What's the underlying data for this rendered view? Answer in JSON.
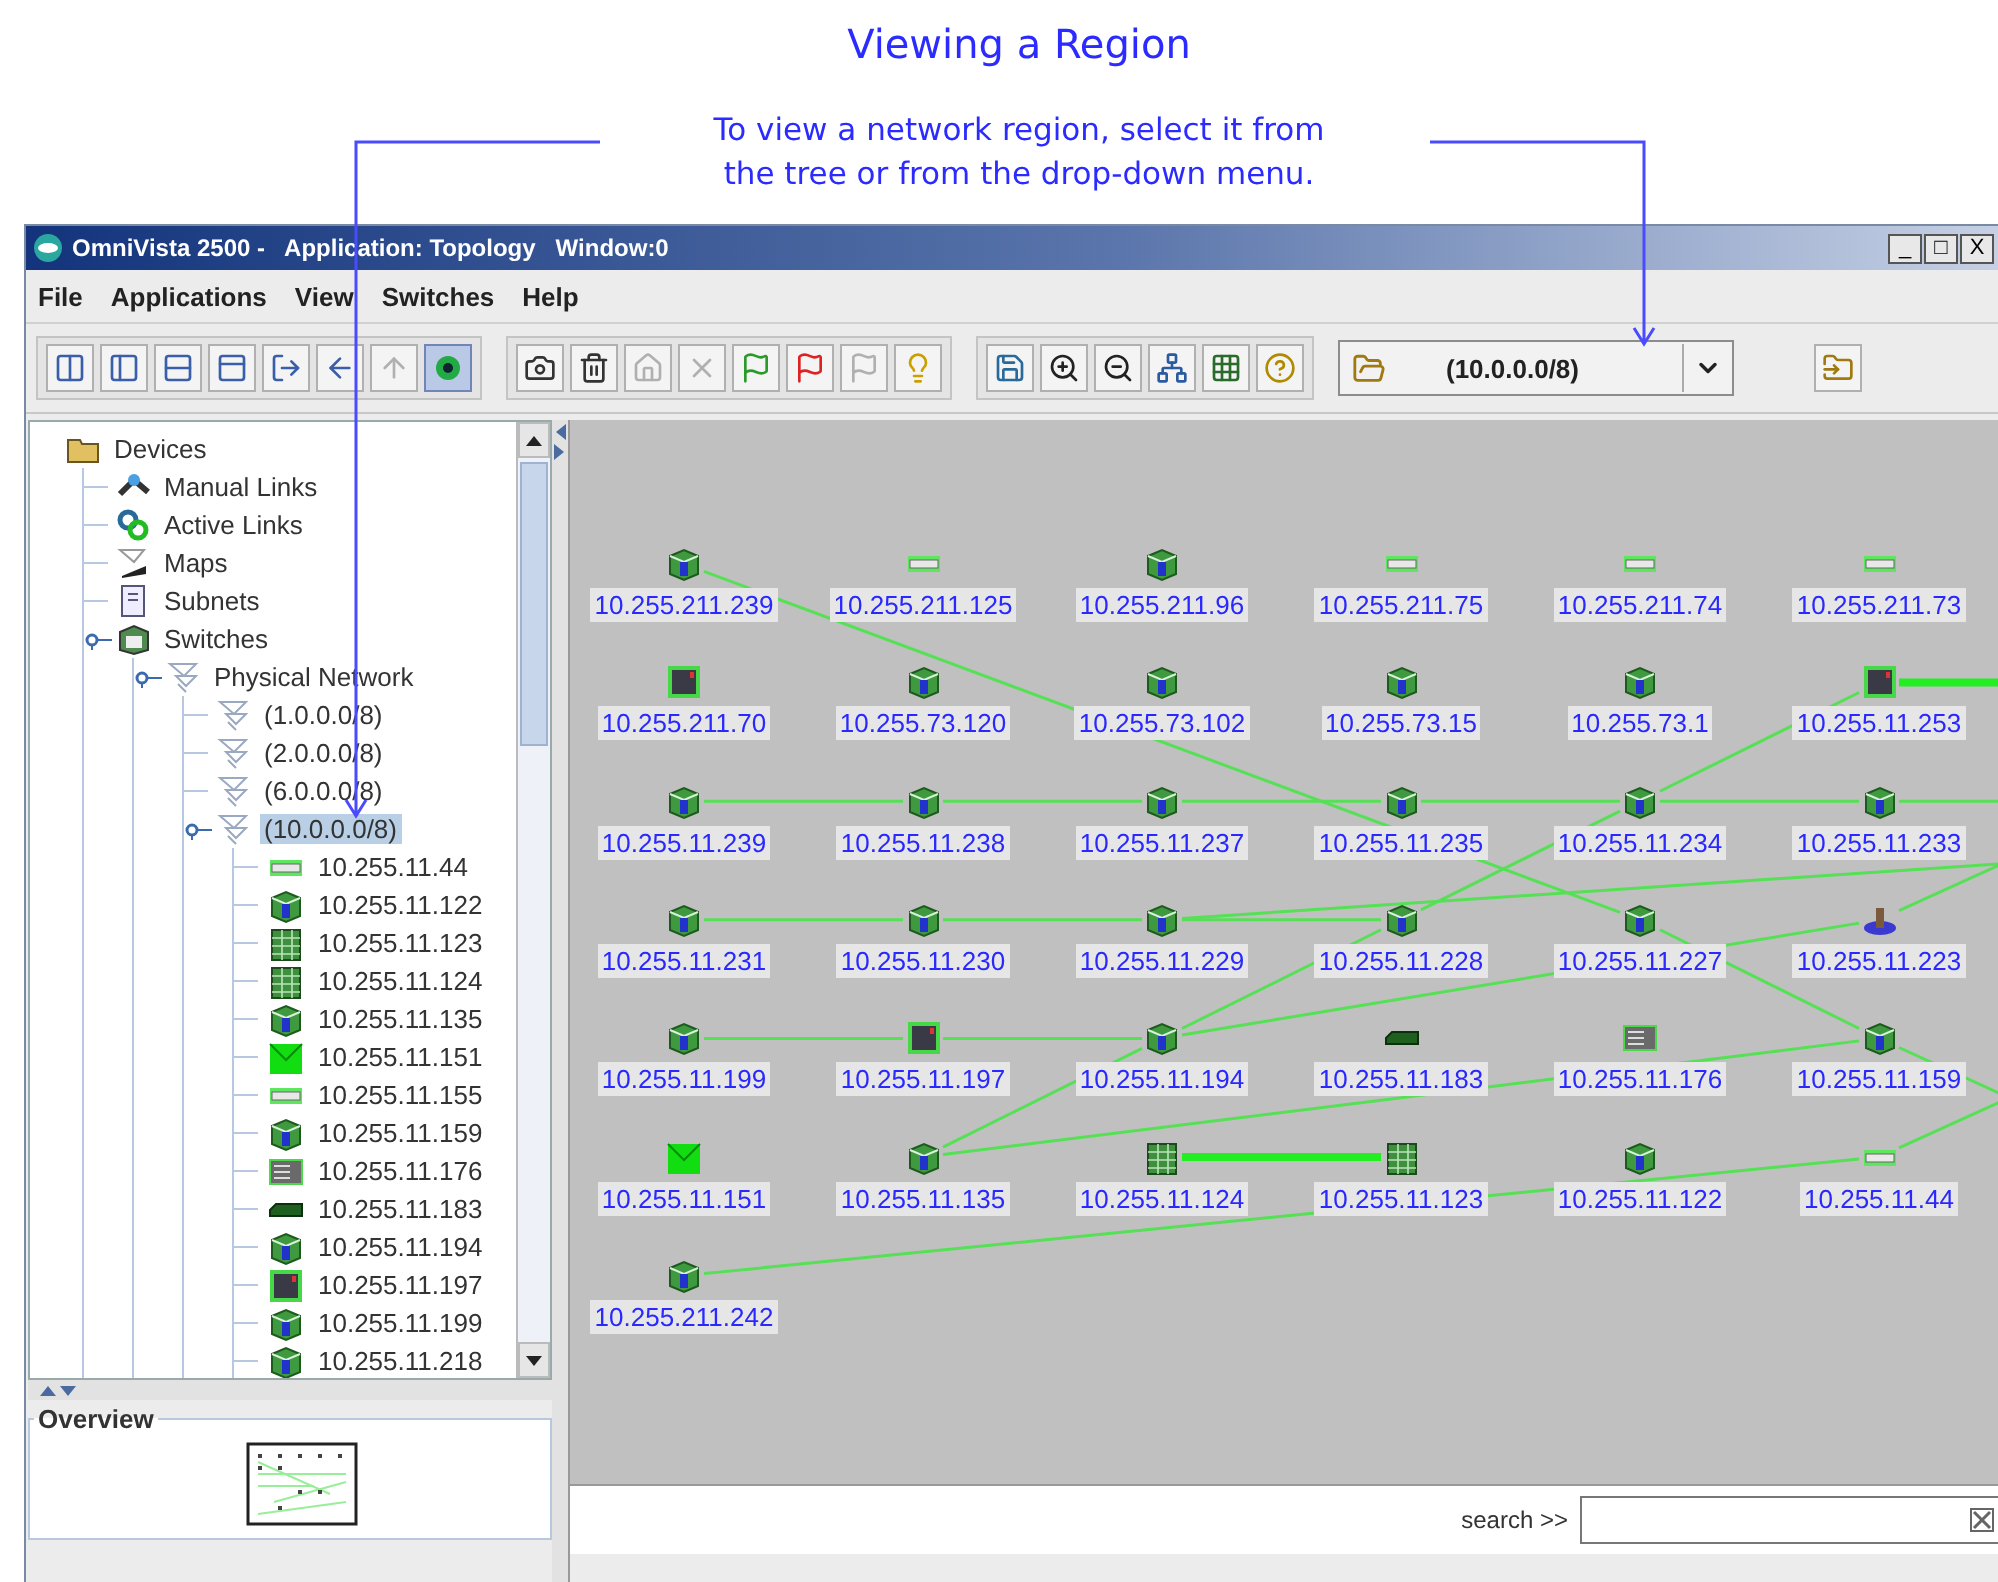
{
  "caption": {
    "title": "Viewing a Region",
    "note": [
      "To view a network region, select it from",
      "the tree or from the drop-down menu."
    ]
  },
  "window": {
    "title": "OmniVista 2500 -   Application: Topology   Window:0",
    "controls": [
      "_",
      "□",
      "X"
    ]
  },
  "menu": [
    "File",
    "Applications",
    "View",
    "Switches",
    "Help"
  ],
  "toolbar": [
    [
      {
        "kind": "panes-columns",
        "disabled": false,
        "pressed": false
      },
      {
        "kind": "panes-left",
        "disabled": false,
        "pressed": false
      },
      {
        "kind": "panes-rows",
        "disabled": false,
        "pressed": false
      },
      {
        "kind": "panes-top",
        "disabled": false,
        "pressed": false
      },
      {
        "kind": "export",
        "disabled": false,
        "pressed": false
      },
      {
        "kind": "back",
        "disabled": false,
        "pressed": false
      },
      {
        "kind": "up",
        "disabled": true,
        "pressed": false
      },
      {
        "kind": "target",
        "disabled": false,
        "pressed": true
      }
    ],
    [
      {
        "kind": "camera",
        "disabled": false,
        "pressed": false
      },
      {
        "kind": "bin",
        "disabled": false,
        "pressed": false
      },
      {
        "kind": "home",
        "disabled": true,
        "pressed": false
      },
      {
        "kind": "close",
        "disabled": true,
        "pressed": false
      },
      {
        "kind": "flag",
        "disabled": false,
        "pressed": false
      },
      {
        "kind": "flag-red",
        "disabled": false,
        "pressed": false
      },
      {
        "kind": "flag",
        "disabled": true,
        "pressed": false
      },
      {
        "kind": "bulb",
        "disabled": false,
        "pressed": false
      }
    ],
    [
      {
        "kind": "save",
        "disabled": false,
        "pressed": false
      },
      {
        "kind": "zoom-in",
        "disabled": false,
        "pressed": false
      },
      {
        "kind": "zoom-out",
        "disabled": false,
        "pressed": false
      },
      {
        "kind": "network",
        "disabled": false,
        "pressed": false
      },
      {
        "kind": "grid",
        "disabled": false,
        "pressed": false
      },
      {
        "kind": "help",
        "disabled": false,
        "pressed": false
      }
    ]
  ],
  "region_dropdown": {
    "value": "(10.0.0.0/8)"
  },
  "tree": [
    {
      "label": "Devices",
      "kind": "folder",
      "selected": false,
      "children": [
        {
          "label": "Manual Links",
          "kind": "manual-links",
          "selected": false,
          "expanded": false
        },
        {
          "label": "Active Links",
          "kind": "active-links",
          "selected": false,
          "expanded": false
        },
        {
          "label": "Maps",
          "kind": "maps",
          "selected": false,
          "expanded": false
        },
        {
          "label": "Subnets",
          "kind": "subnets",
          "selected": false,
          "expanded": false
        },
        {
          "label": "Switches",
          "kind": "switches",
          "selected": false,
          "expanded": true,
          "children": [
            {
              "label": "Physical Network",
              "kind": "network",
              "selected": false,
              "expanded": true,
              "children": [
                {
                  "label": "(1.0.0.0/8)",
                  "kind": "network",
                  "selected": false,
                  "expanded": false
                },
                {
                  "label": "(2.0.0.0/8)",
                  "kind": "network",
                  "selected": false,
                  "expanded": false
                },
                {
                  "label": "(6.0.0.0/8)",
                  "kind": "network",
                  "selected": false,
                  "expanded": false
                },
                {
                  "label": "(10.0.0.0/8)",
                  "kind": "network",
                  "selected": true,
                  "expanded": true,
                  "children": [
                    {
                      "label": "10.255.11.44",
                      "kind": "flat",
                      "selected": false
                    },
                    {
                      "label": "10.255.11.122",
                      "kind": "cube",
                      "selected": false
                    },
                    {
                      "label": "10.255.11.123",
                      "kind": "stack",
                      "selected": false
                    },
                    {
                      "label": "10.255.11.124",
                      "kind": "stack",
                      "selected": false
                    },
                    {
                      "label": "10.255.11.135",
                      "kind": "cube",
                      "selected": false
                    },
                    {
                      "label": "10.255.11.151",
                      "kind": "panel",
                      "selected": false
                    },
                    {
                      "label": "10.255.11.155",
                      "kind": "flat",
                      "selected": false
                    },
                    {
                      "label": "10.255.11.159",
                      "kind": "cube",
                      "selected": false
                    },
                    {
                      "label": "10.255.11.176",
                      "kind": "rack",
                      "selected": false
                    },
                    {
                      "label": "10.255.11.183",
                      "kind": "slim",
                      "selected": false
                    },
                    {
                      "label": "10.255.11.194",
                      "kind": "cube",
                      "selected": false
                    },
                    {
                      "label": "10.255.11.197",
                      "kind": "chassis",
                      "selected": false
                    },
                    {
                      "label": "10.255.11.199",
                      "kind": "cube",
                      "selected": false
                    },
                    {
                      "label": "10.255.11.218",
                      "kind": "cube",
                      "selected": false
                    }
                  ]
                }
              ]
            }
          ]
        }
      ]
    }
  ],
  "overview": {
    "title": "Overview"
  },
  "topology": {
    "nodes": [
      {
        "label": "10.255.211.239",
        "kind": "cube"
      },
      {
        "label": "10.255.211.125",
        "kind": "flat"
      },
      {
        "label": "10.255.211.96",
        "kind": "cube"
      },
      {
        "label": "10.255.211.75",
        "kind": "flat"
      },
      {
        "label": "10.255.211.74",
        "kind": "flat"
      },
      {
        "label": "10.255.211.73",
        "kind": "flat"
      },
      {
        "label": "10.255.211.70",
        "kind": "chassis"
      },
      {
        "label": "10.255.73.120",
        "kind": "cube"
      },
      {
        "label": "10.255.73.102",
        "kind": "cube"
      },
      {
        "label": "10.255.73.15",
        "kind": "cube"
      },
      {
        "label": "10.255.73.1",
        "kind": "cube"
      },
      {
        "label": "10.255.11.253",
        "kind": "chassis"
      },
      {
        "label": "10.255.11.239",
        "kind": "cube"
      },
      {
        "label": "10.255.11.238",
        "kind": "cube"
      },
      {
        "label": "10.255.11.237",
        "kind": "cube"
      },
      {
        "label": "10.255.11.235",
        "kind": "cube"
      },
      {
        "label": "10.255.11.234",
        "kind": "cube"
      },
      {
        "label": "10.255.11.233",
        "kind": "cube"
      },
      {
        "label": "10.255.11.231",
        "kind": "cube"
      },
      {
        "label": "10.255.11.230",
        "kind": "cube"
      },
      {
        "label": "10.255.11.229",
        "kind": "cube"
      },
      {
        "label": "10.255.11.228",
        "kind": "cube"
      },
      {
        "label": "10.255.11.227",
        "kind": "cube"
      },
      {
        "label": "10.255.11.223",
        "kind": "router"
      },
      {
        "label": "10.255.11.199",
        "kind": "cube"
      },
      {
        "label": "10.255.11.197",
        "kind": "chassis"
      },
      {
        "label": "10.255.11.194",
        "kind": "cube"
      },
      {
        "label": "10.255.11.183",
        "kind": "slim"
      },
      {
        "label": "10.255.11.176",
        "kind": "rack"
      },
      {
        "label": "10.255.11.159",
        "kind": "cube"
      },
      {
        "label": "10.255.11.151",
        "kind": "panel"
      },
      {
        "label": "10.255.11.135",
        "kind": "cube"
      },
      {
        "label": "10.255.11.124",
        "kind": "stack"
      },
      {
        "label": "10.255.11.123",
        "kind": "stack"
      },
      {
        "label": "10.255.11.122",
        "kind": "cube"
      },
      {
        "label": "10.255.11.44",
        "kind": "flat"
      },
      {
        "label": "10.255.211.242",
        "kind": "cube"
      }
    ],
    "links": {
      "kind": "lines"
    }
  },
  "search": {
    "label": "search >>"
  }
}
